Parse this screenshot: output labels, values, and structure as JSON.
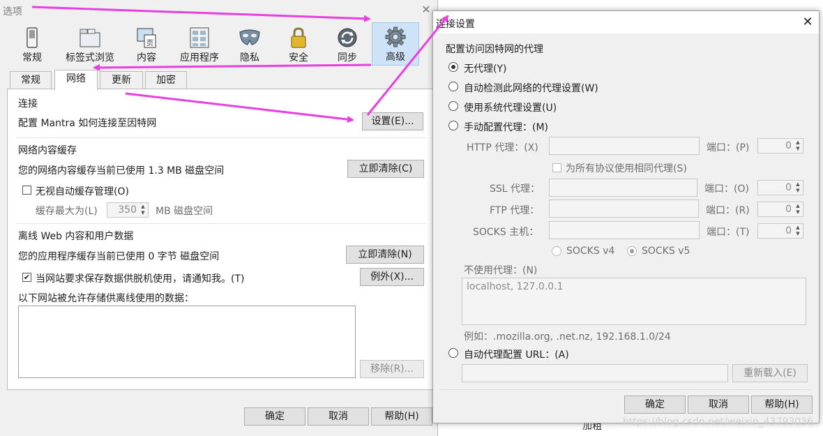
{
  "options": {
    "title": "选项",
    "categories": [
      {
        "label": "常规",
        "icon": "switch-icon"
      },
      {
        "label": "标签式浏览",
        "icon": "tabs-icon"
      },
      {
        "label": "内容",
        "icon": "content-page-icon"
      },
      {
        "label": "应用程序",
        "icon": "applications-icon"
      },
      {
        "label": "隐私",
        "icon": "mask-icon"
      },
      {
        "label": "安全",
        "icon": "padlock-icon"
      },
      {
        "label": "同步",
        "icon": "sync-icon"
      },
      {
        "label": "高级",
        "icon": "gear-icon",
        "selected": true
      }
    ],
    "tabs": [
      {
        "label": "常规"
      },
      {
        "label": "网络",
        "active": true
      },
      {
        "label": "更新"
      },
      {
        "label": "加密"
      }
    ],
    "connection": {
      "heading": "连接",
      "description": "配置 Mantra 如何连接至因特网",
      "settings_button": "设置(E)..."
    },
    "cache": {
      "heading": "网络内容缓存",
      "usage": "您的网络内容缓存当前已使用 1.3 MB 磁盘空间",
      "clear_button": "立即清除(C)",
      "override_label": "无视自动缓存管理(O)",
      "override_checked": false,
      "limit_label": "缓存最大为(L)",
      "limit_value": "350",
      "limit_unit": "MB 磁盘空间"
    },
    "offline": {
      "heading": "离线 Web 内容和用户数据",
      "usage": "您的应用程序缓存当前已使用 0 字节 磁盘空间",
      "clear_button": "立即清除(N)",
      "notify_label": "当网站要求保存数据供脱机使用，请通知我。(T)",
      "notify_checked": true,
      "exceptions_button": "例外(X)...",
      "allowed_label": "以下网站被允许存储供离线使用的数据：",
      "remove_button": "移除(R)..."
    },
    "footer": {
      "ok": "确定",
      "cancel": "取消",
      "help": "帮助(H)"
    }
  },
  "dialog": {
    "title": "连接设置",
    "group_label": "配置访问因特网的代理",
    "options": {
      "no_proxy": "无代理(Y)",
      "auto_detect": "自动检测此网络的代理设置(W)",
      "system": "使用系统代理设置(U)",
      "manual": "手动配置代理：(M)",
      "auto_url": "自动代理配置 URL：(A)"
    },
    "selected_option": "no_proxy",
    "manual": {
      "http_label": "HTTP 代理：(X)",
      "http_port_label": "端口：(P)",
      "http_port": "0",
      "same_proxy_label": "为所有协议使用相同代理(S)",
      "ssl_label": "SSL 代理：",
      "ssl_port_label": "端口：(O)",
      "ssl_port": "0",
      "ftp_label": "FTP 代理：",
      "ftp_port_label": "端口：(R)",
      "ftp_port": "0",
      "socks_label": "SOCKS 主机：",
      "socks_port_label": "端口：(T)",
      "socks_port": "0",
      "socks_v4": "SOCKS v4",
      "socks_v5": "SOCKS v5",
      "socks_selected": "v5"
    },
    "no_proxy_for_label": "不使用代理：(N)",
    "no_proxy_for_value": "localhost, 127.0.0.1",
    "example": "例如：.mozilla.org, .net.nz, 192.168.1.0/24",
    "reload_button": "重新载入(E)",
    "footer": {
      "ok": "确定",
      "cancel": "取消",
      "help": "帮助(H)"
    }
  },
  "background": {
    "partial_text": "加粗",
    "watermark": "https://blog.csdn.net/weixin_43793036"
  },
  "colors": {
    "accent_selected": "#cfe3f8",
    "annotation_arrow": "#e83fe0"
  }
}
